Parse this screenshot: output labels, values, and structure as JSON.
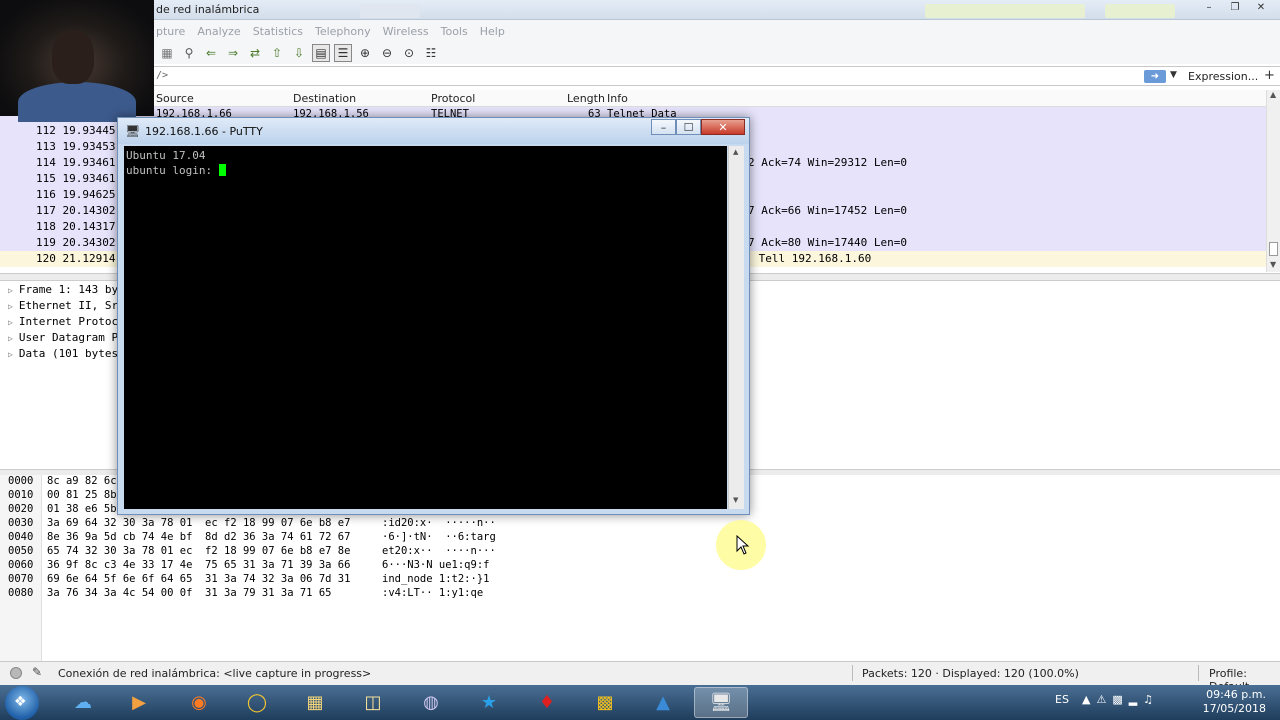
{
  "wireshark": {
    "title": "de red inalámbrica",
    "menu": [
      "pture",
      "Analyze",
      "Statistics",
      "Telephony",
      "Wireless",
      "Tools",
      "Help"
    ],
    "filter": {
      "text": "/>",
      "expression_label": "Expression..."
    },
    "columns": {
      "source": "Source",
      "destination": "Destination",
      "protocol": "Protocol",
      "length": "Length",
      "info": "Info"
    },
    "partial_row": {
      "source": "192.168.1.66",
      "destination": "192.168.1.56",
      "protocol": "TELNET",
      "length": "63",
      "info": "Telnet Data"
    },
    "packets": [
      {
        "no_time": "112 19.93445",
        "info": "",
        "style": "purple"
      },
      {
        "no_time": "113 19.93453",
        "info": "",
        "style": "purple"
      },
      {
        "no_time": "114 19.93461",
        "info": "2 Ack=74 Win=29312 Len=0",
        "style": "purple"
      },
      {
        "no_time": "115 19.93461",
        "info": "",
        "style": "purple"
      },
      {
        "no_time": "116 19.94625",
        "info": "",
        "style": "purple"
      },
      {
        "no_time": "117 20.14302",
        "info": "7 Ack=66 Win=17452 Len=0",
        "style": "purple"
      },
      {
        "no_time": "118 20.14317",
        "info": "",
        "style": "purple"
      },
      {
        "no_time": "119 20.34302",
        "info": "7 Ack=80 Win=17440 Len=0",
        "style": "purple"
      },
      {
        "no_time": "120 21.12914",
        "info": " Tell 192.168.1.60",
        "style": "sel"
      }
    ],
    "details": [
      "Frame 1: 143 by",
      "Ethernet II, Sr",
      "Internet Protoc",
      "User Datagram P",
      "Data (101 bytes"
    ],
    "hex": [
      {
        "off": "0000",
        "bytes": "8c a9 82 6c",
        "ascii": ""
      },
      {
        "off": "0010",
        "bytes": "00 81 25 8b",
        "ascii": ""
      },
      {
        "off": "0020",
        "bytes": "01 38 e6 5b",
        "ascii": ""
      },
      {
        "off": "0030",
        "bytes": "3a 69 64 32 30 3a 78 01  ec f2 18 99 07 6e b8 e7",
        "ascii": ":id20:x·  ·····n··"
      },
      {
        "off": "0040",
        "bytes": "8e 36 9a 5d cb 74 4e bf  8d d2 36 3a 74 61 72 67",
        "ascii": "·6·]·tN·  ··6:targ"
      },
      {
        "off": "0050",
        "bytes": "65 74 32 30 3a 78 01 ec  f2 18 99 07 6e b8 e7 8e",
        "ascii": "et20:x··  ····n···"
      },
      {
        "off": "0060",
        "bytes": "36 9f 8c c3 4e 33 17 4e  75 65 31 3a 71 39 3a 66",
        "ascii": "6···N3·N ue1:q9:f"
      },
      {
        "off": "0070",
        "bytes": "69 6e 64 5f 6e 6f 64 65  31 3a 74 32 3a 06 7d 31",
        "ascii": "ind_node 1:t2:·}1"
      },
      {
        "off": "0080",
        "bytes": "3a 76 34 3a 4c 54 00 0f  31 3a 79 31 3a 71 65",
        "ascii": ":v4:LT·· 1:y1:qe"
      }
    ],
    "status": {
      "capture": "Conexión de red inalámbrica: <live capture in progress>",
      "packets": "Packets: 120 · Displayed: 120 (100.0%)",
      "profile": "Profile: Default"
    }
  },
  "putty": {
    "title": "192.168.1.66 - PuTTY",
    "line1": "Ubuntu 17.04",
    "line2": "ubuntu login: "
  },
  "taskbar": {
    "apps": [
      "internet-explorer",
      "media-player",
      "firefox",
      "chrome",
      "file-explorer",
      "folder",
      "cortana",
      "skype",
      "acrobat",
      "app-yellow",
      "wireshark",
      "putty"
    ],
    "language": "ES",
    "time": "09:46 p.m.",
    "date": "17/05/2018"
  }
}
